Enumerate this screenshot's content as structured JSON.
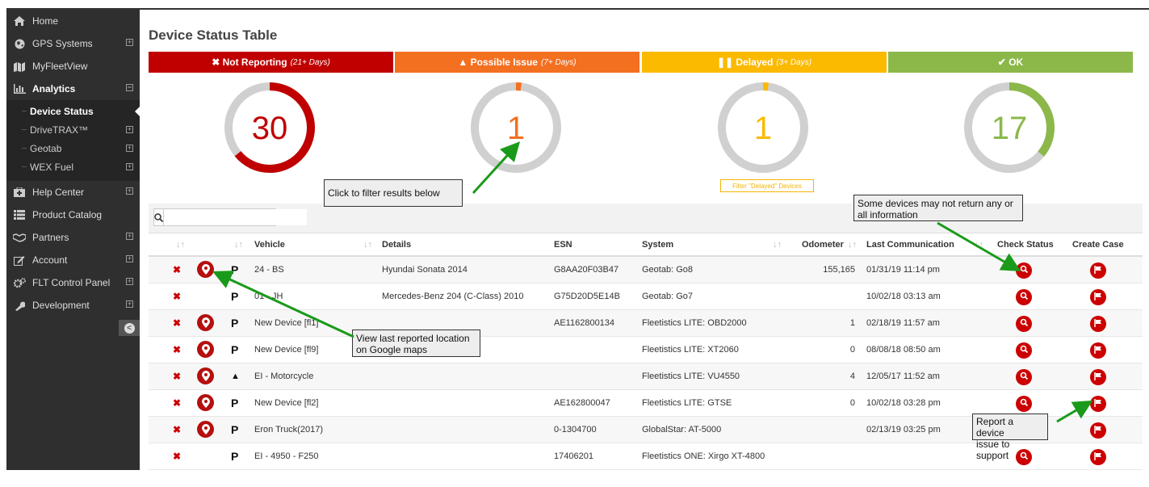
{
  "sidebar": {
    "items": [
      {
        "label": "Home",
        "icon": "home-icon"
      },
      {
        "label": "GPS Systems",
        "icon": "globe-icon"
      },
      {
        "label": "MyFleetView",
        "icon": "map-icon"
      },
      {
        "label": "Analytics",
        "icon": "bar-chart-icon"
      },
      {
        "label": "Help Center",
        "icon": "medkit-icon"
      },
      {
        "label": "Product Catalog",
        "icon": "list-icon"
      },
      {
        "label": "Partners",
        "icon": "handshake-icon"
      },
      {
        "label": "Account",
        "icon": "edit-icon"
      },
      {
        "label": "FLT Control Panel",
        "icon": "cogs-icon"
      },
      {
        "label": "Development",
        "icon": "wrench-icon"
      }
    ],
    "analytics_sub": [
      {
        "label": "Device Status"
      },
      {
        "label": "DriveTRAX™"
      },
      {
        "label": "Geotab"
      },
      {
        "label": "WEX Fuel"
      }
    ]
  },
  "page": {
    "title": "Device Status Table"
  },
  "status": [
    {
      "label": "Not Reporting",
      "range": "(21+ Days)",
      "count": "30",
      "color": "#c00000",
      "fraction": 0.64
    },
    {
      "label": "Possible Issue",
      "range": "(7+ Days)",
      "count": "1",
      "color": "#f37021",
      "fraction": 0.02
    },
    {
      "label": "Delayed",
      "range": "(3+ Days)",
      "count": "1",
      "color": "#fbb900",
      "fraction": 0.02
    },
    {
      "label": "OK",
      "range": "",
      "count": "17",
      "color": "#8cb84a",
      "fraction": 0.36
    }
  ],
  "filter_delayed": "Filter \"Delayed\" Devices",
  "table": {
    "headers": {
      "vehicle": "Vehicle",
      "details": "Details",
      "esn": "ESN",
      "system": "System",
      "odometer": "Odometer",
      "last_comm": "Last Communication",
      "check_status": "Check Status",
      "create_case": "Create Case"
    },
    "rows": [
      {
        "vehicle": "24 - BS",
        "details": "Hyundai Sonata 2014",
        "esn": "G8AA20F03B47",
        "system": "Geotab: Go8",
        "odometer": "155,165",
        "last": "01/31/19 11:14 pm",
        "type": "P",
        "pin": true
      },
      {
        "vehicle": "01 - JH",
        "details": "Mercedes-Benz 204 (C-Class) 2010",
        "esn": "G75D20D5E14B",
        "system": "Geotab: Go7",
        "odometer": "",
        "last": "10/02/18 03:13 am",
        "type": "P",
        "pin": false
      },
      {
        "vehicle": "New Device [fl1]",
        "details": "",
        "esn": "AE1162800134",
        "system": "Fleetistics LITE: OBD2000",
        "odometer": "1",
        "last": "02/18/19 11:57 am",
        "type": "P",
        "pin": true
      },
      {
        "vehicle": "New Device [fl9]",
        "details": "",
        "esn": "",
        "system": "Fleetistics LITE: XT2060",
        "odometer": "0",
        "last": "08/08/18 08:50 am",
        "type": "P",
        "pin": true
      },
      {
        "vehicle": "EI - Motorcycle",
        "details": "",
        "esn": "",
        "system": "Fleetistics LITE: VU4550",
        "odometer": "4",
        "last": "12/05/17 11:52 am",
        "type": "road",
        "pin": true
      },
      {
        "vehicle": "New Device [fl2]",
        "details": "",
        "esn": "AE162800047",
        "system": "Fleetistics LITE: GTSE",
        "odometer": "0",
        "last": "10/02/18 03:28 pm",
        "type": "P",
        "pin": true
      },
      {
        "vehicle": "Eron Truck(2017)",
        "details": "",
        "esn": "0-1304700",
        "system": "GlobalStar: AT-5000",
        "odometer": "",
        "last": "02/13/19 03:25 pm",
        "type": "P",
        "pin": true
      },
      {
        "vehicle": "EI - 4950 - F250",
        "details": "",
        "esn": "17406201",
        "system": "Fleetistics ONE: Xirgo XT-4800",
        "odometer": "",
        "last": "",
        "type": "P",
        "pin": false
      }
    ]
  },
  "callouts": {
    "filter": "Click to filter results below",
    "no_info_1": "Some devices may not return any or",
    "no_info_2": "all information",
    "maps_1": "View last reported location",
    "maps_2": "on Google maps",
    "report_1": "Report a device",
    "report_2": "issue to support"
  }
}
